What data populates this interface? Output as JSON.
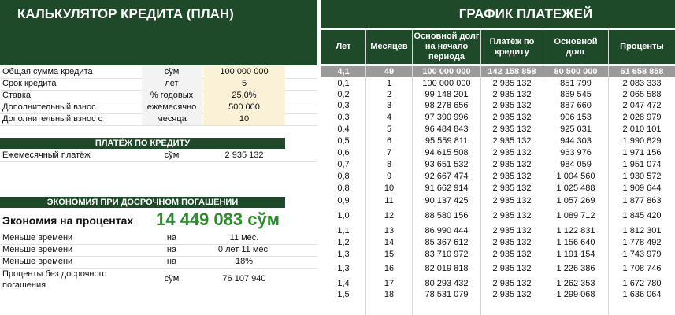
{
  "calc_title": "КАЛЬКУЛЯТОР КРЕДИТА (ПЛАН)",
  "params": [
    {
      "label": "Общая сумма кредита",
      "unit": "сўм",
      "value": "100 000 000"
    },
    {
      "label": "Срок кредита",
      "unit": "лет",
      "value": "5"
    },
    {
      "label": "Ставка",
      "unit": "% годовых",
      "value": "25,0%"
    },
    {
      "label": "Дополнительный взнос",
      "unit": "ежемесячно",
      "value": "500 000"
    },
    {
      "label": "Дополнительный взнос с",
      "unit": "месяца",
      "value": "10"
    }
  ],
  "payment_section": {
    "title": "ПЛАТЁЖ ПО КРЕДИТУ",
    "label": "Ежемесячный платёж",
    "unit": "сўм",
    "value": "2 935 132"
  },
  "savings_section": {
    "title": "ЭКОНОМИЯ ПРИ ДОСРОЧНОМ ПОГАШЕНИИ",
    "headline_label": "Экономия на процентах",
    "headline_value": "14 449 083 сўм",
    "rows": [
      {
        "label": "Меньше времени",
        "unit": "на",
        "value": "11 мес."
      },
      {
        "label": "Меньше времени",
        "unit": "на",
        "value": "0 лет 11 мес."
      },
      {
        "label": "Меньше времени",
        "unit": "на",
        "value": "18%"
      }
    ],
    "last_label": "Проценты без досрочного погашения",
    "last_unit": "сўм",
    "last_value": "76 107 940"
  },
  "schedule": {
    "title": "ГРАФИК ПЛАТЕЖЕЙ",
    "headers": [
      "Лет",
      "Месяцев",
      "Основной долг на начало периода",
      "Платёж по кредиту",
      "Основной долг",
      "Проценты"
    ],
    "summary": [
      "4,1",
      "49",
      "100 000 000",
      "142 158 858",
      "80 500 000",
      "61 658 858"
    ],
    "rows": [
      [
        "0,1",
        "1",
        "100 000 000",
        "2 935 132",
        "851 799",
        "2 083 333"
      ],
      [
        "0,2",
        "2",
        "99 148 201",
        "2 935 132",
        "869 545",
        "2 065 588"
      ],
      [
        "0,3",
        "3",
        "98 278 656",
        "2 935 132",
        "887 660",
        "2 047 472"
      ],
      [
        "0,3",
        "4",
        "97 390 996",
        "2 935 132",
        "906 153",
        "2 028 979"
      ],
      [
        "0,4",
        "5",
        "96 484 843",
        "2 935 132",
        "925 031",
        "2 010 101"
      ],
      [
        "0,5",
        "6",
        "95 559 811",
        "2 935 132",
        "944 303",
        "1 990 829"
      ],
      [
        "0,6",
        "7",
        "94 615 508",
        "2 935 132",
        "963 976",
        "1 971 156"
      ],
      [
        "0,7",
        "8",
        "93 651 532",
        "2 935 132",
        "984 059",
        "1 951 074"
      ],
      [
        "0,8",
        "9",
        "92 667 474",
        "2 935 132",
        "1 004 560",
        "1 930 572"
      ],
      [
        "0,8",
        "10",
        "91 662 914",
        "2 935 132",
        "1 025 488",
        "1 909 644"
      ],
      [
        "0,9",
        "11",
        "90 137 425",
        "2 935 132",
        "1 057 269",
        "1 877 863"
      ],
      [
        "1,0",
        "12",
        "88 580 156",
        "2 935 132",
        "1 089 712",
        "1 845 420"
      ],
      [
        "1,1",
        "13",
        "86 990 444",
        "2 935 132",
        "1 122 831",
        "1 812 301"
      ],
      [
        "1,2",
        "14",
        "85 367 612",
        "2 935 132",
        "1 156 640",
        "1 778 492"
      ],
      [
        "1,3",
        "15",
        "83 710 972",
        "2 935 132",
        "1 191 154",
        "1 743 979"
      ],
      [
        "1,3",
        "16",
        "82 019 818",
        "2 935 132",
        "1 226 386",
        "1 708 746"
      ],
      [
        "1,4",
        "17",
        "80 293 432",
        "2 935 132",
        "1 262 353",
        "1 672 780"
      ],
      [
        "1,5",
        "18",
        "78 531 079",
        "2 935 132",
        "1 299 068",
        "1 636 064"
      ]
    ]
  }
}
